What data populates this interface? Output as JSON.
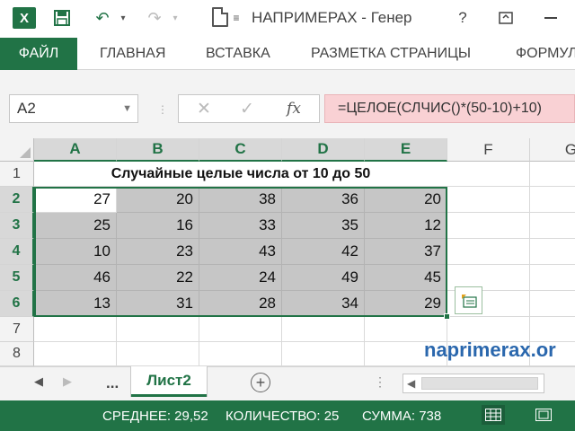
{
  "window": {
    "app_logo": "X",
    "title": "НАПРИМЕРАХ - Генер",
    "help_label": "?",
    "icons": [
      "excel-logo-icon",
      "save-icon",
      "undo-icon",
      "redo-icon",
      "new-document-icon",
      "customize-quick-access-icon",
      "help-icon",
      "ribbon-display-options-icon",
      "minimize-icon"
    ]
  },
  "ribbon": {
    "tabs": [
      "ФАЙЛ",
      "ГЛАВНАЯ",
      "ВСТАВКА",
      "РАЗМЕТКА СТРАНИЦЫ",
      "ФОРМУЛ"
    ]
  },
  "formula_bar": {
    "name_box": "A2",
    "formula": "=ЦЕЛОЕ(СЛЧИС()*(50-10)+10)",
    "fx_label": "fx"
  },
  "grid": {
    "columns": [
      "A",
      "B",
      "C",
      "D",
      "E",
      "F",
      "G"
    ],
    "rows": [
      "1",
      "2",
      "3",
      "4",
      "5",
      "6",
      "7",
      "8"
    ],
    "title_cell": "Случайные целые числа от 10 до 50",
    "values": [
      [
        "27",
        "20",
        "38",
        "36",
        "20"
      ],
      [
        "25",
        "16",
        "33",
        "35",
        "12"
      ],
      [
        "10",
        "23",
        "43",
        "42",
        "37"
      ],
      [
        "46",
        "22",
        "24",
        "49",
        "45"
      ],
      [
        "13",
        "31",
        "28",
        "34",
        "29"
      ]
    ],
    "selection": "A2:E6",
    "active_cell": "A2"
  },
  "watermark": "naprimerax.or",
  "sheets": {
    "more_label": "...",
    "active": "Лист2",
    "add_label": "+"
  },
  "status_bar": {
    "average": "СРЕДНЕЕ: 29,52",
    "count": "КОЛИЧЕСТВО: 25",
    "sum": "СУММА: 738"
  },
  "colors": {
    "accent": "#217346",
    "selection_fill": "#c6c6c6",
    "formula_highlight": "#f9d1d4",
    "watermark": "#2a67ad"
  }
}
